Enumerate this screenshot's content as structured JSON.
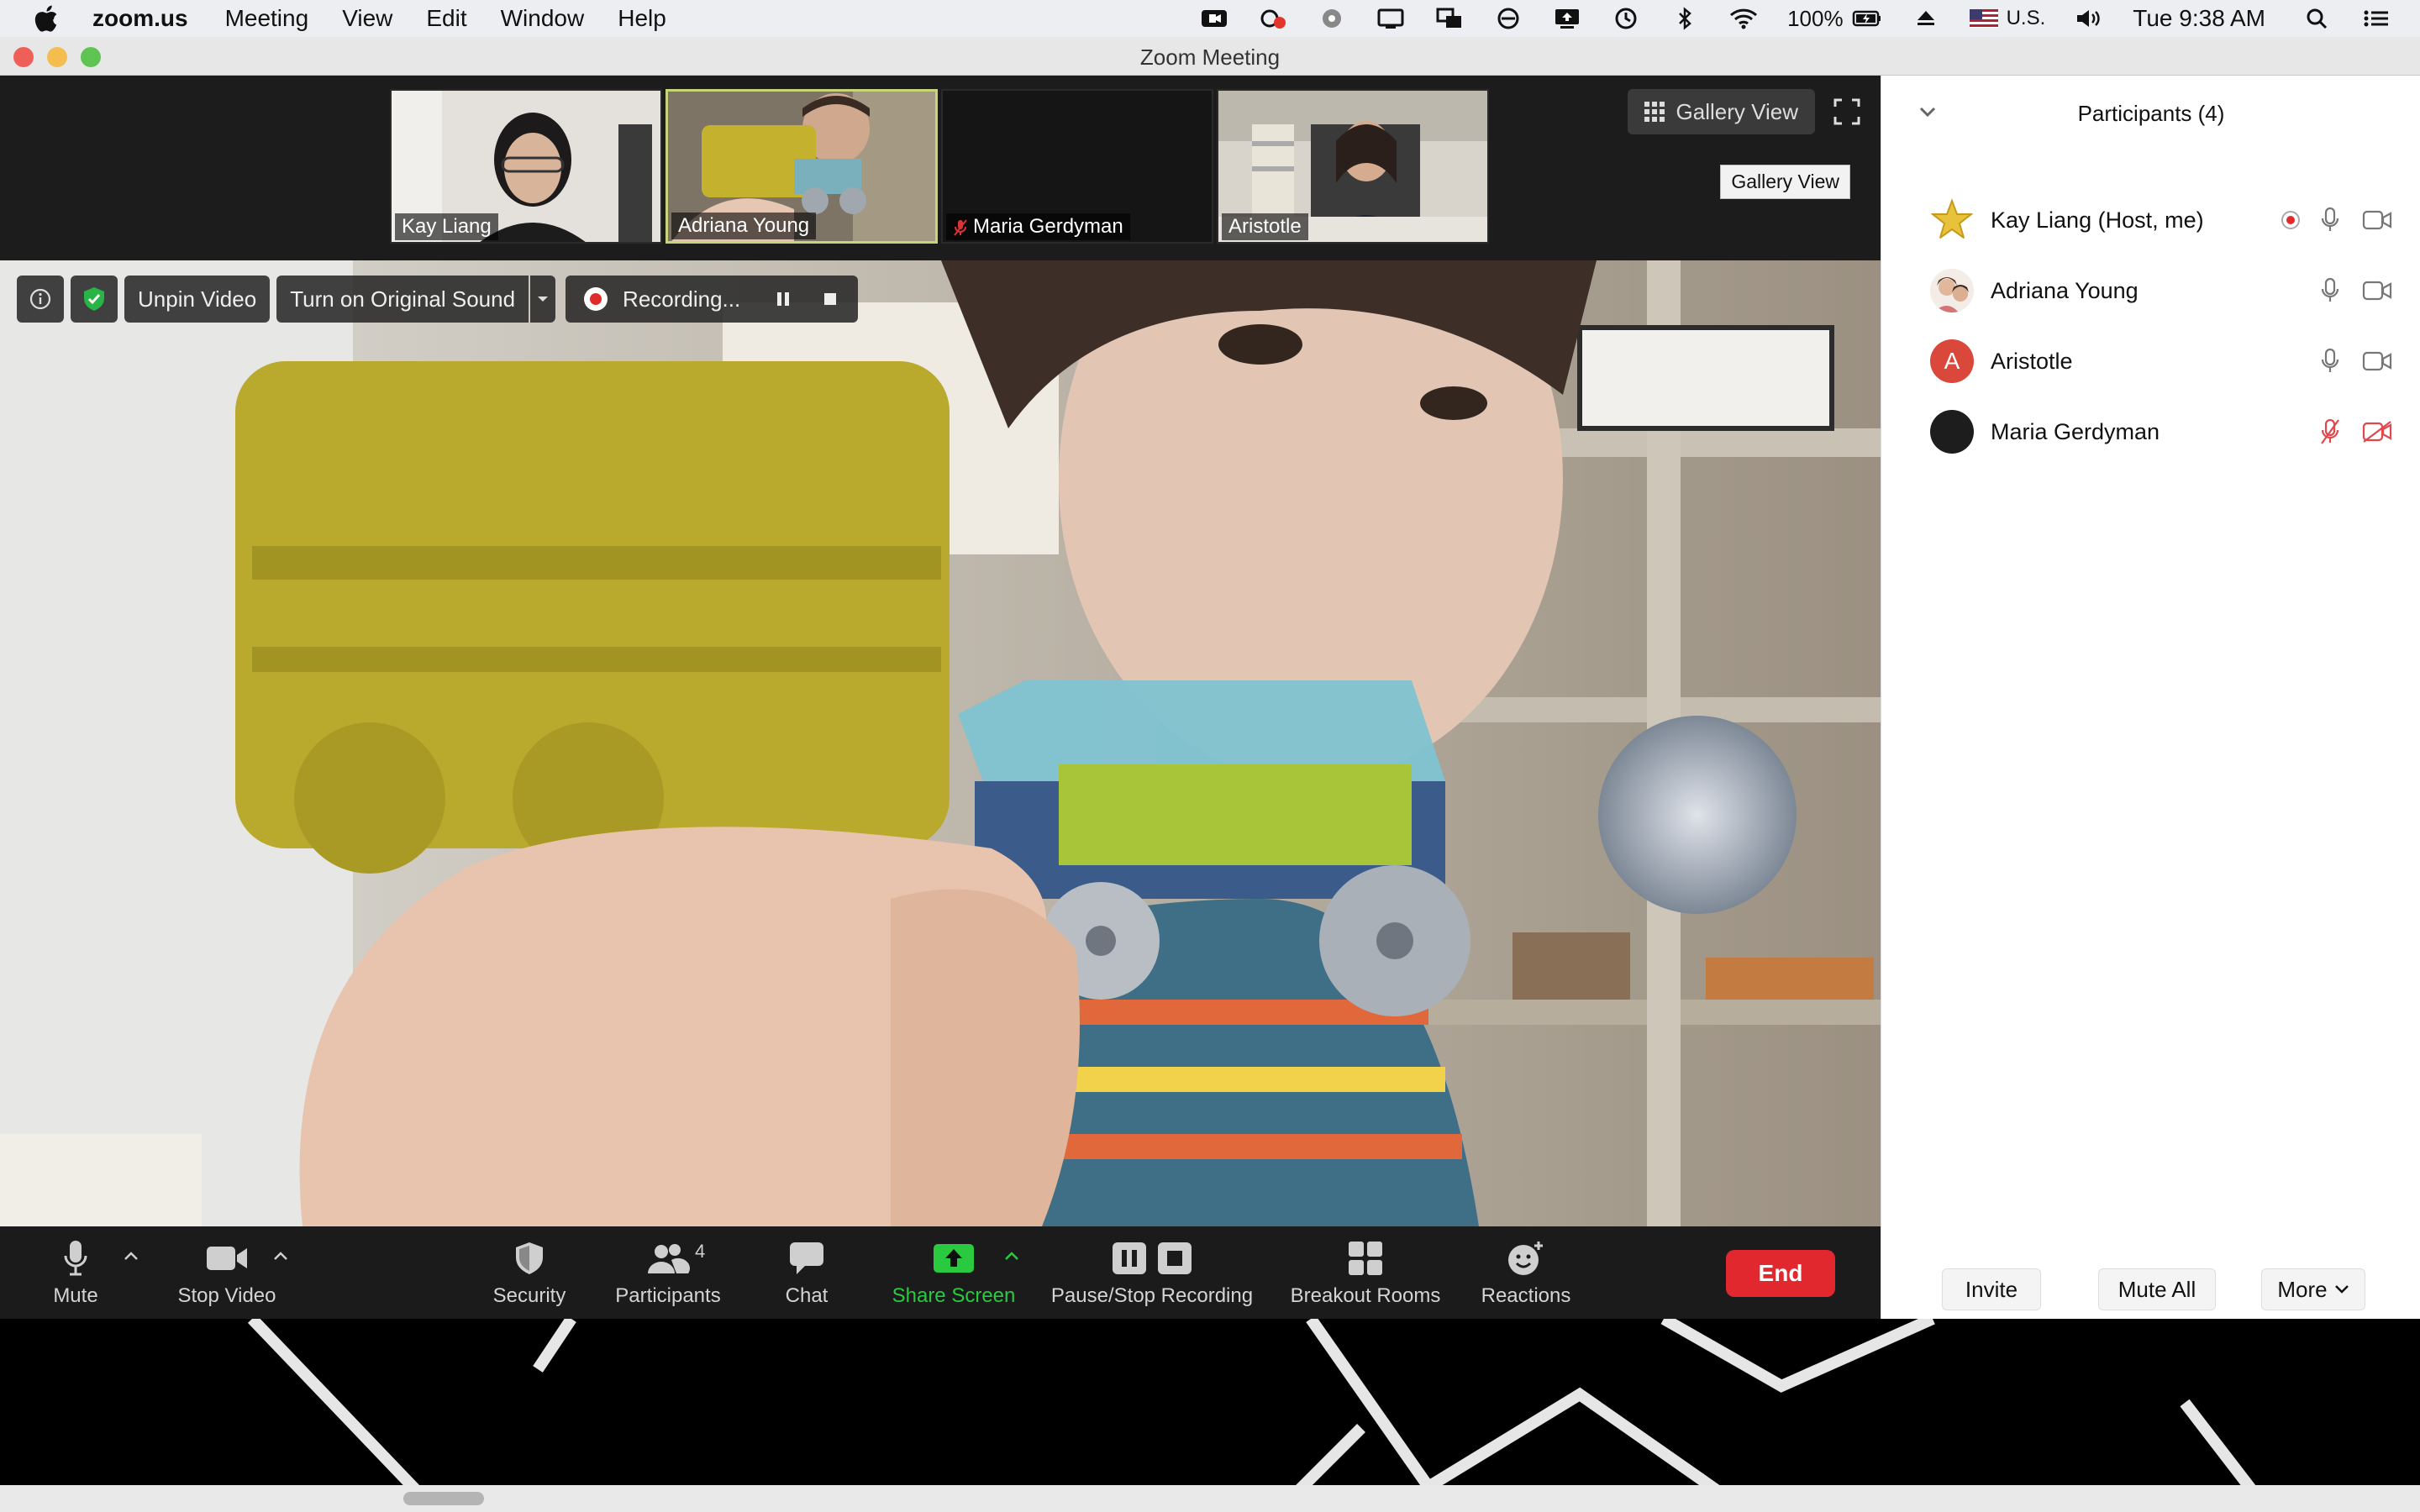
{
  "menubar": {
    "app_name": "zoom.us",
    "menus": [
      "Meeting",
      "View",
      "Edit",
      "Window",
      "Help"
    ],
    "battery": "100%",
    "input_source": "U.S.",
    "clock": "Tue 9:38 AM"
  },
  "window": {
    "title": "Zoom Meeting"
  },
  "filmstrip": {
    "thumbnails": [
      {
        "name": "Kay Liang",
        "muted": false,
        "active": false
      },
      {
        "name": "Adriana Young",
        "muted": false,
        "active": true
      },
      {
        "name": "Maria Gerdyman",
        "muted": true,
        "active": false
      },
      {
        "name": "Aristotle",
        "muted": false,
        "active": false
      }
    ]
  },
  "view_controls": {
    "gallery_label": "Gallery View",
    "tooltip": "Gallery View"
  },
  "video_toolbar": {
    "unpin_label": "Unpin Video",
    "original_sound_label": "Turn on Original Sound",
    "recording_label": "Recording..."
  },
  "meeting_toolbar": {
    "mute": "Mute",
    "stop_video": "Stop Video",
    "security": "Security",
    "participants": "Participants",
    "participants_count": "4",
    "chat": "Chat",
    "share_screen": "Share Screen",
    "pause_stop_recording": "Pause/Stop Recording",
    "breakout_rooms": "Breakout Rooms",
    "reactions": "Reactions",
    "end": "End",
    "share_color": "#29c940",
    "end_color": "#e0282e"
  },
  "participants_panel": {
    "title": "Participants (4)",
    "rows": [
      {
        "name": "Kay Liang (Host, me)",
        "avatar": "star",
        "recording": true,
        "mic_muted": false,
        "video_off": false
      },
      {
        "name": "Adriana Young",
        "avatar": "photo",
        "recording": false,
        "mic_muted": false,
        "video_off": false
      },
      {
        "name": "Aristotle",
        "avatar": "letter",
        "avatar_letter": "A",
        "avatar_color": "#d9483b",
        "recording": false,
        "mic_muted": false,
        "video_off": false
      },
      {
        "name": "Maria Gerdyman",
        "avatar": "black",
        "recording": false,
        "mic_muted": true,
        "video_off": true
      }
    ],
    "invite": "Invite",
    "mute_all": "Mute All",
    "more": "More"
  }
}
